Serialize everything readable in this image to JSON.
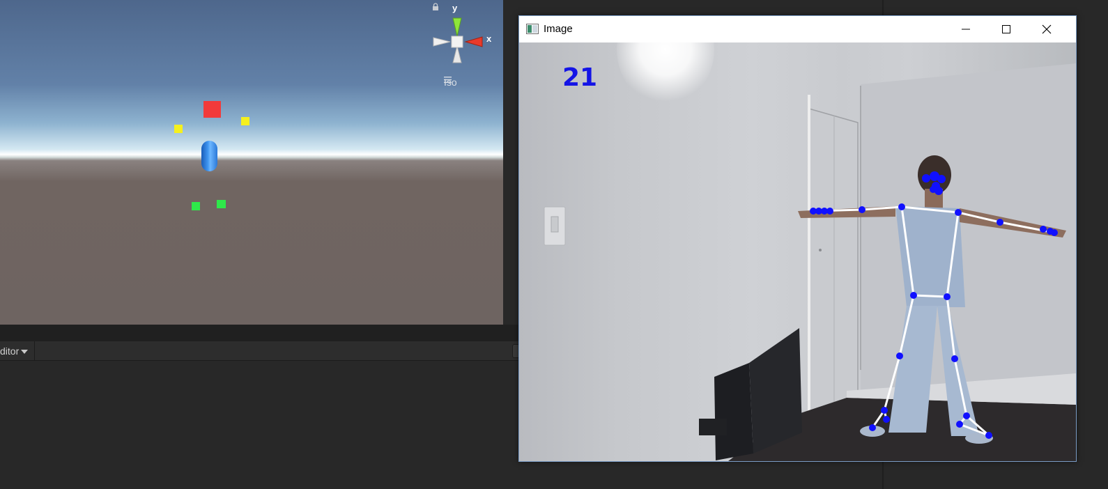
{
  "scene_view": {
    "gizmo": {
      "y_label": "y",
      "x_label": "x",
      "projection_label": "Iso"
    },
    "colors": {
      "head_marker": "#f23a3a",
      "hand_marker": "#f5f01e",
      "foot_marker": "#2ee84a",
      "capsule": "#3f95f0"
    }
  },
  "bottom_panel": {
    "dropdown_label": "ditor"
  },
  "image_window": {
    "title": "Image",
    "frame_counter": "21",
    "overlay_colors": {
      "joint": "#1010ff",
      "bone": "#ffffff"
    }
  }
}
